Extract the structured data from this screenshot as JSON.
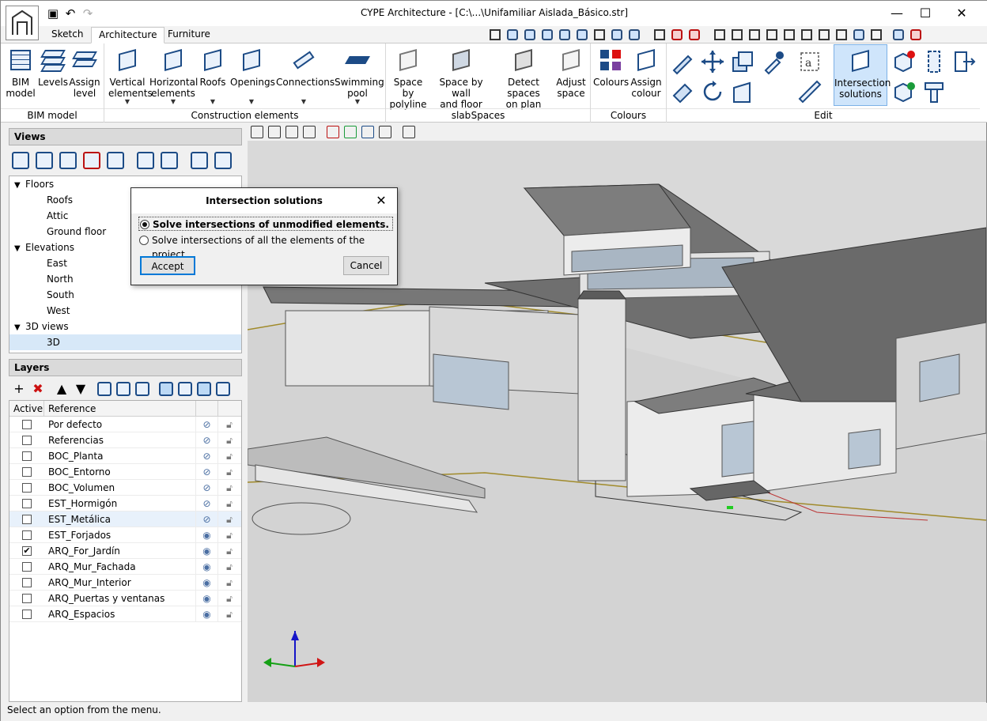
{
  "window": {
    "title": "CYPE Architecture - [C:\\...\\Unifamiliar Aislada_Básico.str]"
  },
  "tabs": [
    {
      "label": "Sketch",
      "active": false
    },
    {
      "label": "Architecture",
      "active": true
    },
    {
      "label": "Furniture",
      "active": false
    }
  ],
  "ribbon": {
    "groups": [
      {
        "label": "BIM model"
      },
      {
        "label": "Construction elements"
      },
      {
        "label": "Spaces"
      },
      {
        "label": "Colours"
      },
      {
        "label": "Edit"
      }
    ],
    "bim_model": [
      {
        "line1": "BIM",
        "line2": "model"
      },
      {
        "line1": "Levels",
        "line2": ""
      },
      {
        "line1": "Assign",
        "line2": "level"
      }
    ],
    "construction": [
      {
        "line1": "Vertical",
        "line2": "elements"
      },
      {
        "line1": "Horizontal",
        "line2": "elements"
      },
      {
        "line1": "Roofs",
        "line2": ""
      },
      {
        "line1": "Openings",
        "line2": ""
      },
      {
        "line1": "Connections",
        "line2": ""
      },
      {
        "line1": "Swimming",
        "line2": "pool"
      }
    ],
    "spaces": [
      {
        "line1": "Space by",
        "line2": "polyline"
      },
      {
        "line1": "Space by wall",
        "line2": "and floor slab"
      },
      {
        "line1": "Detect spaces",
        "line2": "on plan"
      },
      {
        "line1": "Adjust",
        "line2": "space"
      }
    ],
    "colours": [
      {
        "line1": "Colours",
        "line2": ""
      },
      {
        "line1": "Assign",
        "line2": "colour"
      }
    ],
    "edit": {
      "intersection": {
        "line1": "Intersection",
        "line2": "solutions"
      }
    }
  },
  "views": {
    "header": "Views",
    "tree": [
      {
        "label": "Floors",
        "level": 0
      },
      {
        "label": "Roofs",
        "level": 1
      },
      {
        "label": "Attic",
        "level": 1
      },
      {
        "label": "Ground floor",
        "level": 1
      },
      {
        "label": "Elevations",
        "level": 0
      },
      {
        "label": "East",
        "level": 1
      },
      {
        "label": "North",
        "level": 1
      },
      {
        "label": "South",
        "level": 1
      },
      {
        "label": "West",
        "level": 1
      },
      {
        "label": "3D views",
        "level": 0
      },
      {
        "label": "3D",
        "level": 1,
        "selected": true
      }
    ]
  },
  "layers": {
    "header": "Layers",
    "columns": {
      "active": "Active",
      "reference": "Reference"
    },
    "rows": [
      {
        "name": "Por defecto",
        "active": false,
        "visible": false
      },
      {
        "name": "Referencias",
        "active": false,
        "visible": false
      },
      {
        "name": "BOC_Planta",
        "active": false,
        "visible": false
      },
      {
        "name": "BOC_Entorno",
        "active": false,
        "visible": false
      },
      {
        "name": "BOC_Volumen",
        "active": false,
        "visible": false
      },
      {
        "name": "EST_Hormigón",
        "active": false,
        "visible": false
      },
      {
        "name": "EST_Metálica",
        "active": false,
        "visible": false,
        "selected": true
      },
      {
        "name": "EST_Forjados",
        "active": false,
        "visible": true
      },
      {
        "name": "ARQ_For_Jardín",
        "active": true,
        "visible": true
      },
      {
        "name": "ARQ_Mur_Fachada",
        "active": false,
        "visible": true
      },
      {
        "name": "ARQ_Mur_Interior",
        "active": false,
        "visible": true
      },
      {
        "name": "ARQ_Puertas y ventanas",
        "active": false,
        "visible": true
      },
      {
        "name": "ARQ_Espacios",
        "active": false,
        "visible": true
      }
    ]
  },
  "dialog": {
    "title": "Intersection solutions",
    "option1": "Solve intersections of unmodified elements.",
    "option2": "Solve intersections of all the elements of the project.",
    "accept": "Accept",
    "cancel": "Cancel"
  },
  "status": {
    "text": "Select an option from the menu."
  }
}
